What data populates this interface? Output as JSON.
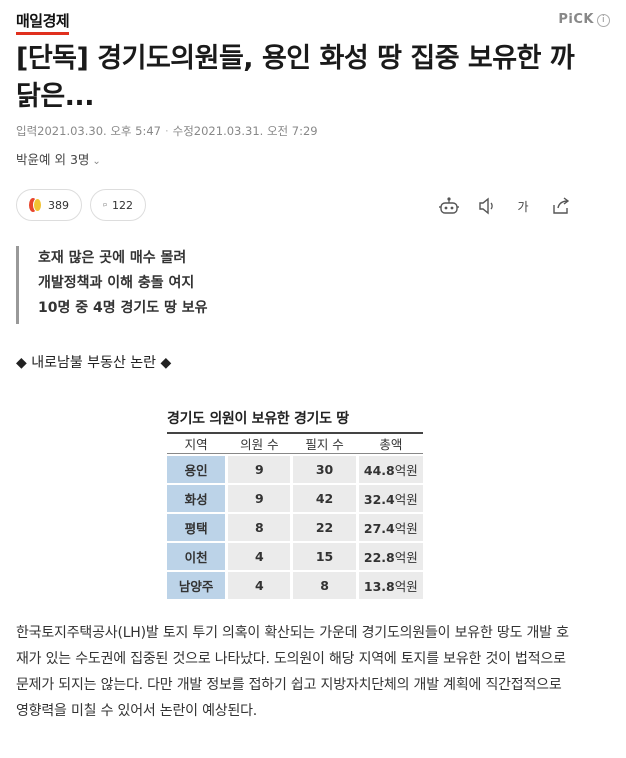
{
  "press": {
    "name": "매일경제"
  },
  "pick": {
    "label": "PiCK",
    "info": "i"
  },
  "article": {
    "title": "[단독] 경기도의원들, 용인 화성 땅 집중 보유한 까닭은...",
    "input_label": "입력",
    "input_time": "2021.03.30. 오후 5:47",
    "modified_label": "수정",
    "modified_time": "2021.03.31. 오전 7:29",
    "author": "박윤예 외 3명"
  },
  "actions": {
    "reaction_count": "389",
    "comment_count": "122",
    "font_label": "가"
  },
  "summary": [
    "호재 많은 곳에 매수 몰려",
    "개발정책과 이해 충돌 여지",
    "10명 중 4명 경기도 땅 보유"
  ],
  "subhead": "◆ 내로남불 부동산 논란 ◆",
  "table": {
    "title": "경기도 의원이 보유한 경기도 땅",
    "headers": [
      "지역",
      "의원 수",
      "필지 수",
      "총액"
    ],
    "rows": [
      {
        "region": "용인",
        "members": "9",
        "parcels": "30",
        "amount": "44.8",
        "unit": "억원"
      },
      {
        "region": "화성",
        "members": "9",
        "parcels": "42",
        "amount": "32.4",
        "unit": "억원"
      },
      {
        "region": "평택",
        "members": "8",
        "parcels": "22",
        "amount": "27.4",
        "unit": "억원"
      },
      {
        "region": "이천",
        "members": "4",
        "parcels": "15",
        "amount": "22.8",
        "unit": "억원"
      },
      {
        "region": "남양주",
        "members": "4",
        "parcels": "8",
        "amount": "13.8",
        "unit": "억원"
      }
    ]
  },
  "body": "한국토지주택공사(LH)발 토지 투기 의혹이 확산되는 가운데 경기도의원들이 보유한 땅도 개발 호재가 있는 수도권에 집중된 것으로 나타났다. 도의원이 해당 지역에 토지를 보유한 것이 법적으로 문제가 되지는 않는다. 다만 개발 정보를 접하기 쉽고 지방자치단체의 개발 계획에 직간접적으로 영향력을 미칠 수 있어서 논란이 예상된다."
}
